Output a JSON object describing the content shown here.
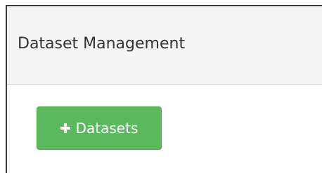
{
  "panel": {
    "title": "Dataset Management"
  },
  "actions": {
    "add_button": {
      "label": "Datasets",
      "icon": "plus-icon",
      "color": "#5cb85c"
    }
  }
}
